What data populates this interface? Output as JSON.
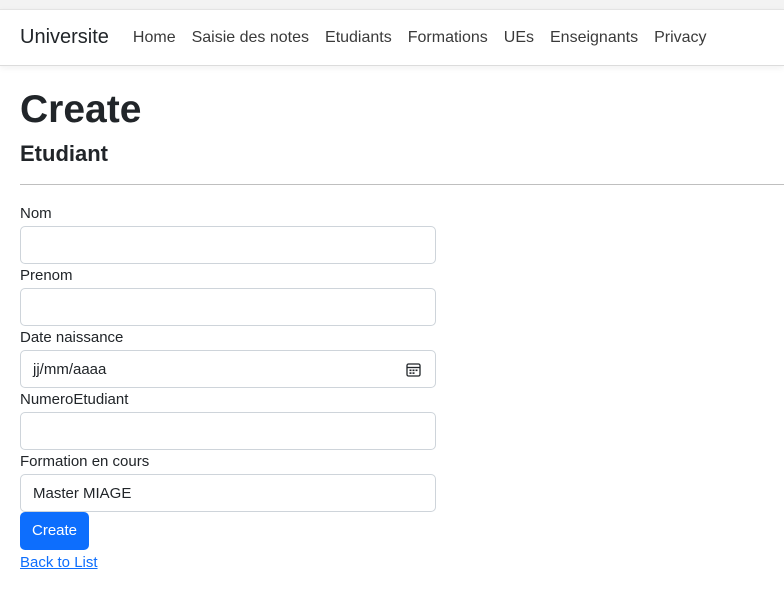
{
  "navbar": {
    "brand": "Universite",
    "links": [
      "Home",
      "Saisie des notes",
      "Etudiants",
      "Formations",
      "UEs",
      "Enseignants",
      "Privacy"
    ]
  },
  "page": {
    "title": "Create",
    "entity": "Etudiant"
  },
  "form": {
    "nom_label": "Nom",
    "nom_value": "",
    "prenom_label": "Prenom",
    "prenom_value": "",
    "date_label": "Date naissance",
    "date_value": "jj/mm/aaaa",
    "numero_label": "NumeroEtudiant",
    "numero_value": "",
    "formation_label": "Formation en cours",
    "formation_value": "Master MIAGE",
    "submit_label": "Create",
    "back_label": "Back to List"
  },
  "icons": {
    "date_picker": "calendar-icon"
  },
  "colors": {
    "primary": "#0d6efd"
  }
}
